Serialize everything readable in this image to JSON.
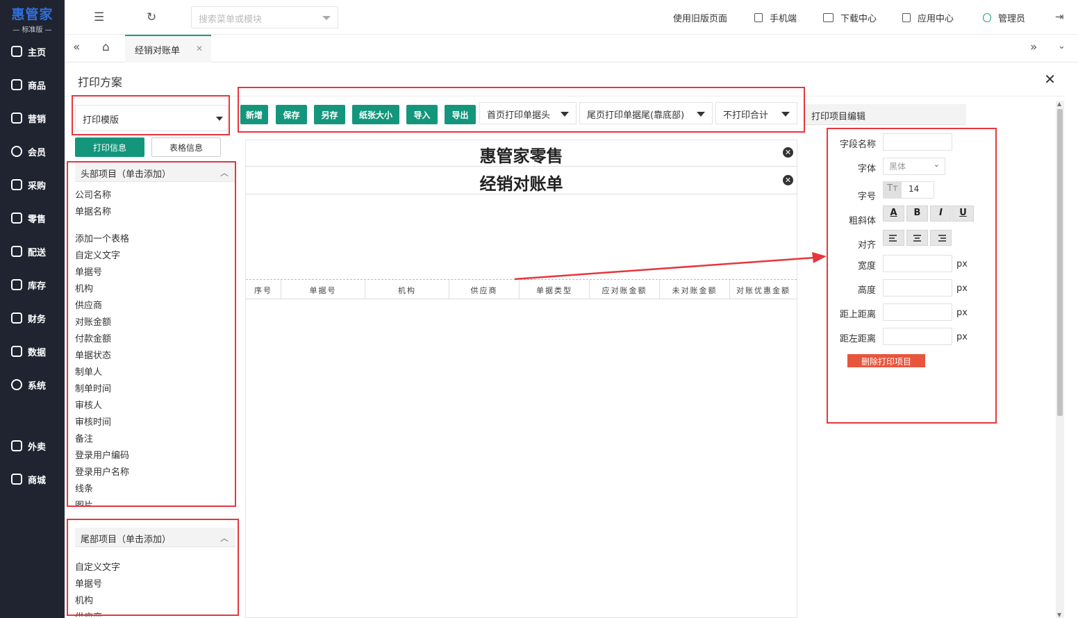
{
  "app": {
    "logo": "惠管家",
    "edition": "标准版"
  },
  "sidebar": {
    "items": [
      {
        "label": "主页",
        "icon": "home-icon"
      },
      {
        "label": "商品",
        "icon": "box-icon"
      },
      {
        "label": "营销",
        "icon": "chart-icon"
      },
      {
        "label": "会员",
        "icon": "heart-icon"
      },
      {
        "label": "采购",
        "icon": "cart-icon"
      },
      {
        "label": "零售",
        "icon": "bag-icon"
      },
      {
        "label": "配送",
        "icon": "truck-icon"
      },
      {
        "label": "库存",
        "icon": "warehouse-icon"
      },
      {
        "label": "财务",
        "icon": "yen-icon"
      },
      {
        "label": "数据",
        "icon": "data-icon"
      },
      {
        "label": "系统",
        "icon": "system-icon"
      },
      {
        "label": "外卖",
        "icon": "delivery-icon"
      },
      {
        "label": "商城",
        "icon": "shop-icon"
      }
    ]
  },
  "topbar": {
    "search_placeholder": "搜索菜单或模块",
    "links": {
      "old_page": "使用旧版页面",
      "mobile": "手机端",
      "download": "下载中心",
      "apps": "应用中心",
      "user": "管理员"
    }
  },
  "tabs": {
    "active": "经销对账单"
  },
  "panel": {
    "title": "打印方案",
    "template_select": "打印模版",
    "btn_print_info": "打印信息",
    "btn_table_info": "表格信息",
    "header_section": "头部项目（单击添加）",
    "header_items": [
      "公司名称",
      "单据名称",
      "",
      "添加一个表格",
      "自定义文字",
      "单据号",
      "机构",
      "供应商",
      "对账金额",
      "付款金额",
      "单据状态",
      "制单人",
      "制单时间",
      "审核人",
      "审核时间",
      "备注",
      "登录用户编码",
      "登录用户名称",
      "线条",
      "图片"
    ],
    "footer_section": "尾部项目（单击添加）",
    "footer_items": [
      "自定义文字",
      "单据号",
      "机构",
      "供应商"
    ]
  },
  "toolbar": {
    "new": "新增",
    "save": "保存",
    "save_as": "另存",
    "paper_size": "纸张大小",
    "import": "导入",
    "export": "导出",
    "first_page_header": "首页打印单据头",
    "last_page_footer": "尾页打印单据尾(靠底部)",
    "no_total": "不打印合计"
  },
  "canvas": {
    "company": "惠管家零售",
    "doc_name": "经销对账单",
    "columns": [
      "序号",
      "单据号",
      "机构",
      "供应商",
      "单据类型",
      "应对账金额",
      "未对账金额",
      "对账优惠金额"
    ]
  },
  "editor": {
    "tab": "打印项目编辑",
    "field_name": "字段名称",
    "font": "字体",
    "font_value": "黑体",
    "size": "字号",
    "size_value": "14",
    "style": "粗斜体",
    "align": "对齐",
    "width": "宽度",
    "height": "高度",
    "top": "距上距离",
    "left": "距左距离",
    "unit": "px",
    "delete": "删除打印项目",
    "style_buttons": [
      "A",
      "B",
      "I",
      "U"
    ]
  },
  "colors": {
    "accent": "#14967c",
    "highlight_box": "#e8353d",
    "sidebar": "#1f2430",
    "danger": "#e8553d"
  }
}
